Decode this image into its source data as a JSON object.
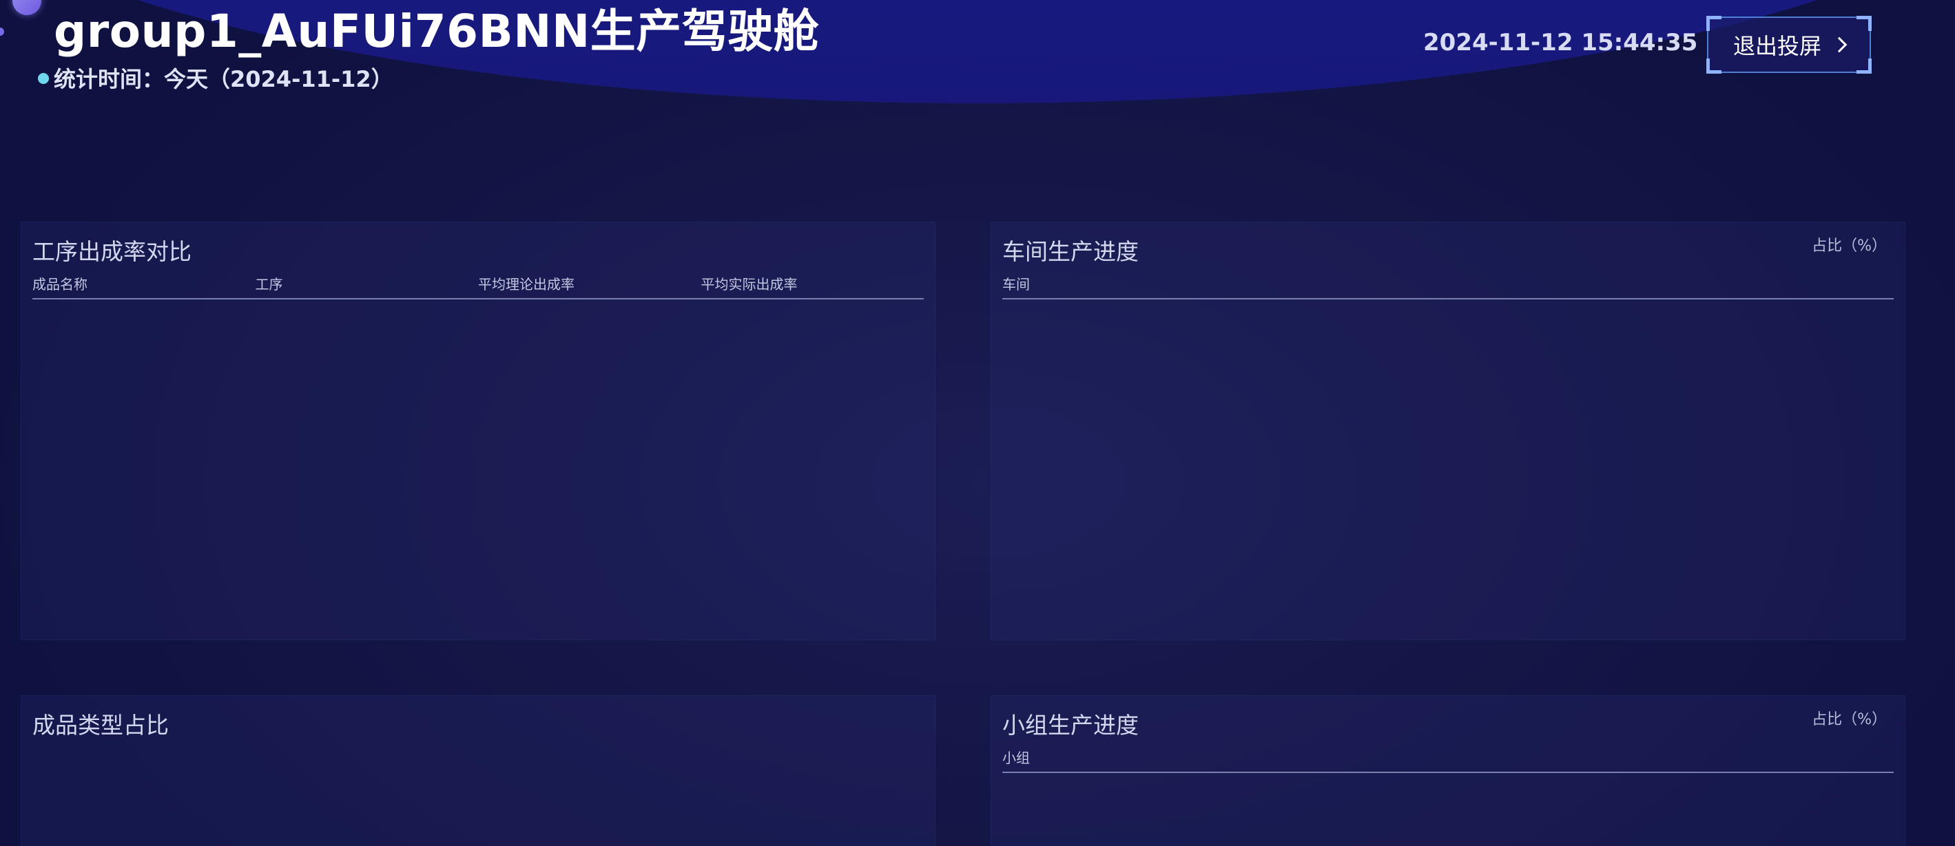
{
  "header": {
    "title": "group1_AuFUi76BNN生产驾驶舱",
    "stat_time": "统计时间：今天（2024-11-12）",
    "datetime": "2024-11-12 15:44:35",
    "exit_label": "退出投屏"
  },
  "panels": {
    "yield": {
      "title": "工序出成率对比",
      "columns": [
        "成品名称",
        "工序",
        "平均理论出成率",
        "平均实际出成率"
      ]
    },
    "workshop": {
      "title": "车间生产进度",
      "unit": "占比（%）",
      "columns": [
        "车间"
      ]
    },
    "product_type": {
      "title": "成品类型占比"
    },
    "group": {
      "title": "小组生产进度",
      "unit": "占比（%）",
      "columns": [
        "小组"
      ]
    }
  },
  "colors": {
    "background": "#121443",
    "banner": "#1a1b86",
    "accent": "#6fd8ee",
    "button_border": "#4f7fd6"
  }
}
